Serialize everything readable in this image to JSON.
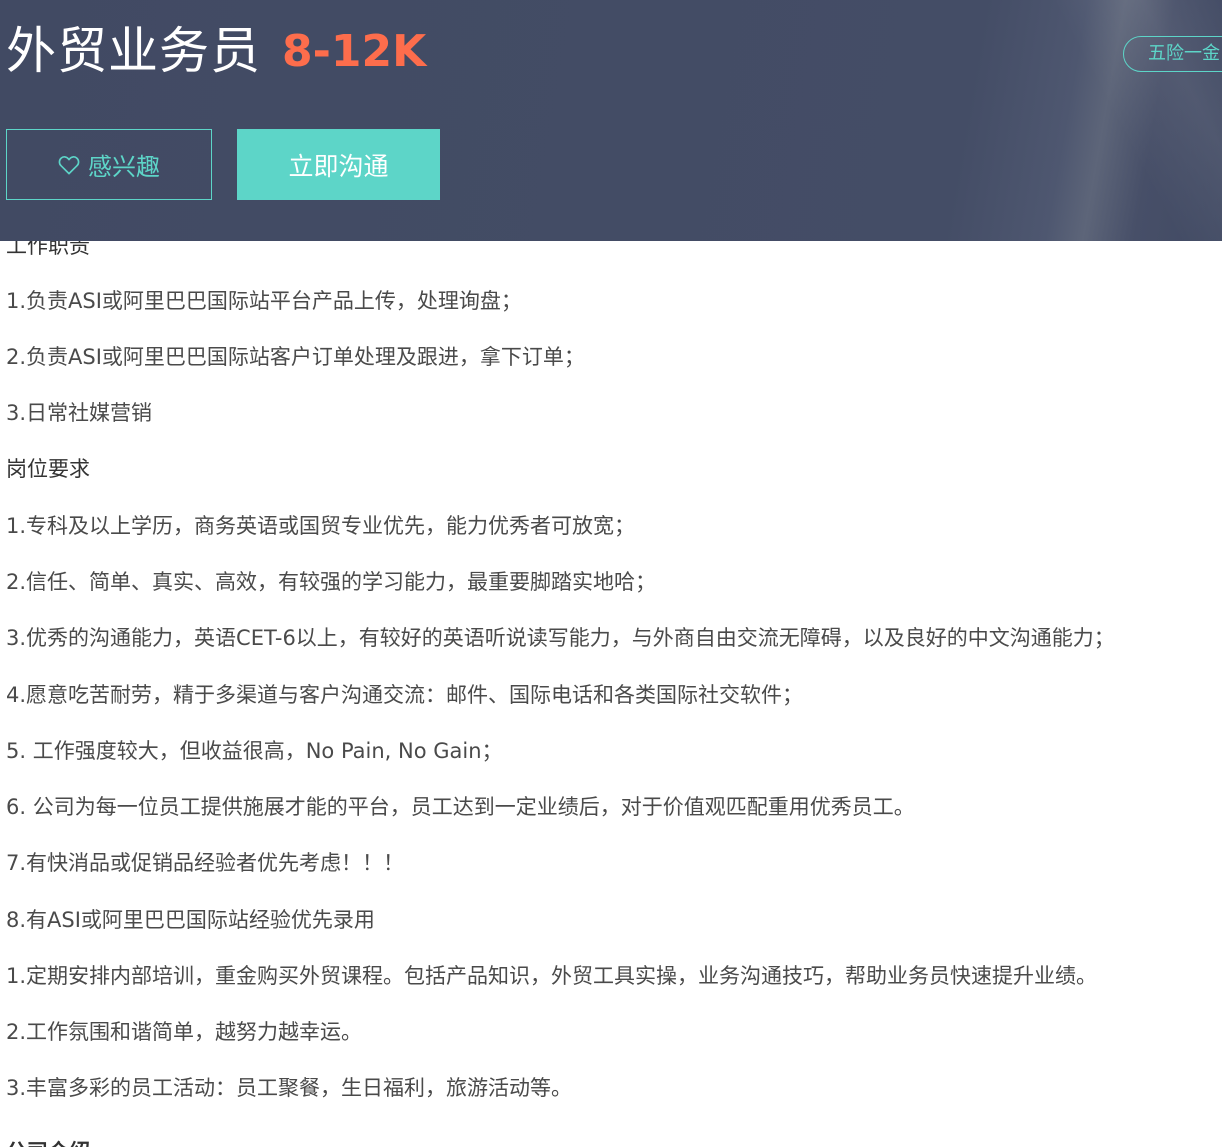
{
  "job": {
    "title": "外贸业务员",
    "salary": "8-12K",
    "tag": "五险一金"
  },
  "actions": {
    "interest_label": "感兴趣",
    "chat_label": "立即沟通"
  },
  "description": {
    "lines": [
      "工作职责",
      "1.负责ASI或阿里巴巴国际站平台产品上传，处理询盘；",
      "2.负责ASI或阿里巴巴国际站客户订单处理及跟进，拿下订单；",
      "3.日常社媒营销",
      "岗位要求",
      "1.专科及以上学历，商务英语或国贸专业优先，能力优秀者可放宽；",
      "2.信任、简单、真实、高效，有较强的学习能力，最重要脚踏实地哈；",
      "3.优秀的沟通能力，英语CET-6以上，有较好的英语听说读写能力，与外商自由交流无障碍，以及良好的中文沟通能力；",
      "4.愿意吃苦耐劳，精于多渠道与客户沟通交流：邮件、国际电话和各类国际社交软件；",
      "5. 工作强度较大，但收益很高，No Pain, No Gain；",
      "6. 公司为每一位员工提供施展才能的平台，员工达到一定业绩后，对于价值观匹配重用优秀员工。",
      "7.有快消品或促销品经验者优先考虑！！！",
      "8.有ASI或阿里巴巴国际站经验优先录用",
      "1.定期安排内部培训，重金购买外贸课程。包括产品知识，外贸工具实操，业务沟通技巧，帮助业务员快速提升业绩。",
      "2.工作氛围和谐简单，越努力越幸运。",
      "3.丰富多彩的员工活动：员工聚餐，生日福利，旅游活动等。",
      "公司介绍"
    ]
  },
  "colors": {
    "header_bg": "#414a63",
    "accent": "#5dd5c8",
    "salary": "#fd6d4c",
    "body_text": "#4a4a4a"
  },
  "icons": {
    "interest": "heart-outline-icon"
  }
}
